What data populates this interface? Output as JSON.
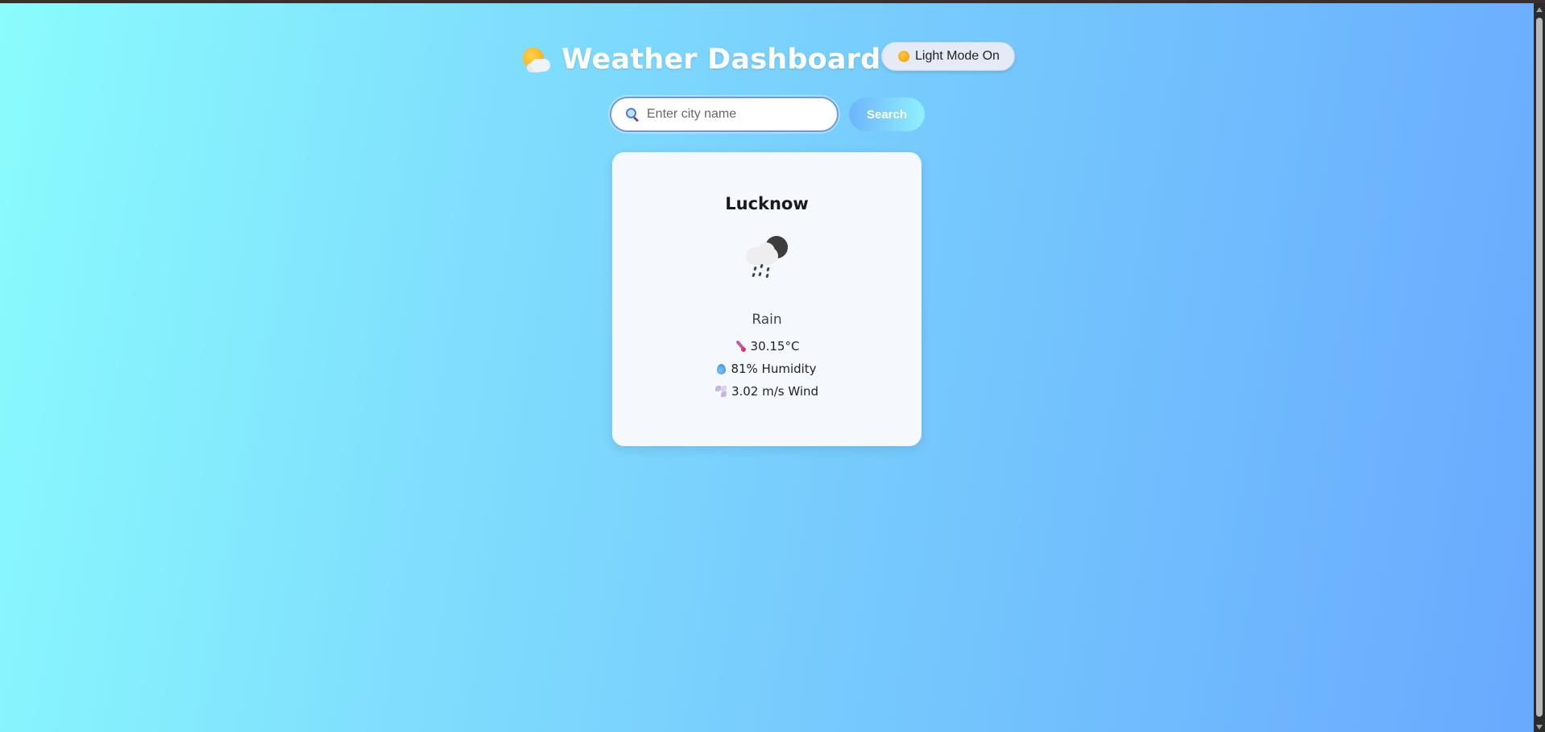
{
  "header": {
    "title": "Weather Dashboard",
    "title_icon": "sun-behind-cloud-icon"
  },
  "mode_toggle": {
    "label": "Light Mode On",
    "icon": "sun-icon"
  },
  "search": {
    "placeholder": "Enter city name",
    "value": "",
    "icon": "search-icon",
    "button_label": "Search"
  },
  "weather": {
    "city": "Lucknow",
    "icon": "rain-night-icon",
    "condition": "Rain",
    "temperature": "30.15°C",
    "humidity": "81% Humidity",
    "wind": "3.02 m/s Wind"
  },
  "colors": {
    "background_start": "#8afcfd",
    "background_end": "#69a9fe",
    "card": "#f5f9fd",
    "search_border": "#6f96e6"
  }
}
